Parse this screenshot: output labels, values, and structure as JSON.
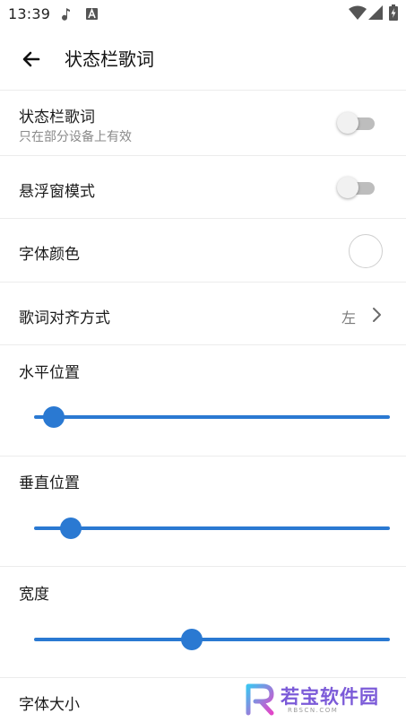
{
  "status_bar": {
    "time": "13:39"
  },
  "header": {
    "title": "状态栏歌词"
  },
  "settings": {
    "status_bar_lyrics": {
      "title": "状态栏歌词",
      "subtitle": "只在部分设备上有效",
      "enabled": false
    },
    "floating_window": {
      "title": "悬浮窗模式",
      "enabled": false
    },
    "font_color": {
      "title": "字体颜色",
      "value_color": "#ffffff"
    },
    "lyric_alignment": {
      "title": "歌词对齐方式",
      "value": "左"
    },
    "horizontal_position": {
      "title": "水平位置",
      "level": 0.055
    },
    "vertical_position": {
      "title": "垂直位置",
      "level": 0.103
    },
    "width": {
      "title": "宽度",
      "level": 0.444
    },
    "font_size": {
      "title": "字体大小"
    }
  },
  "watermark": {
    "text": "若宝软件园",
    "url": "RBSCN.COM"
  },
  "colors": {
    "accent": "#2a79d2",
    "switch_off_track": "#bdbdbd"
  },
  "icons": [
    "music-note-icon",
    "a-box-icon",
    "wifi-icon",
    "signal-icon",
    "battery-icon",
    "arrow-back-icon",
    "chevron-right-icon"
  ]
}
